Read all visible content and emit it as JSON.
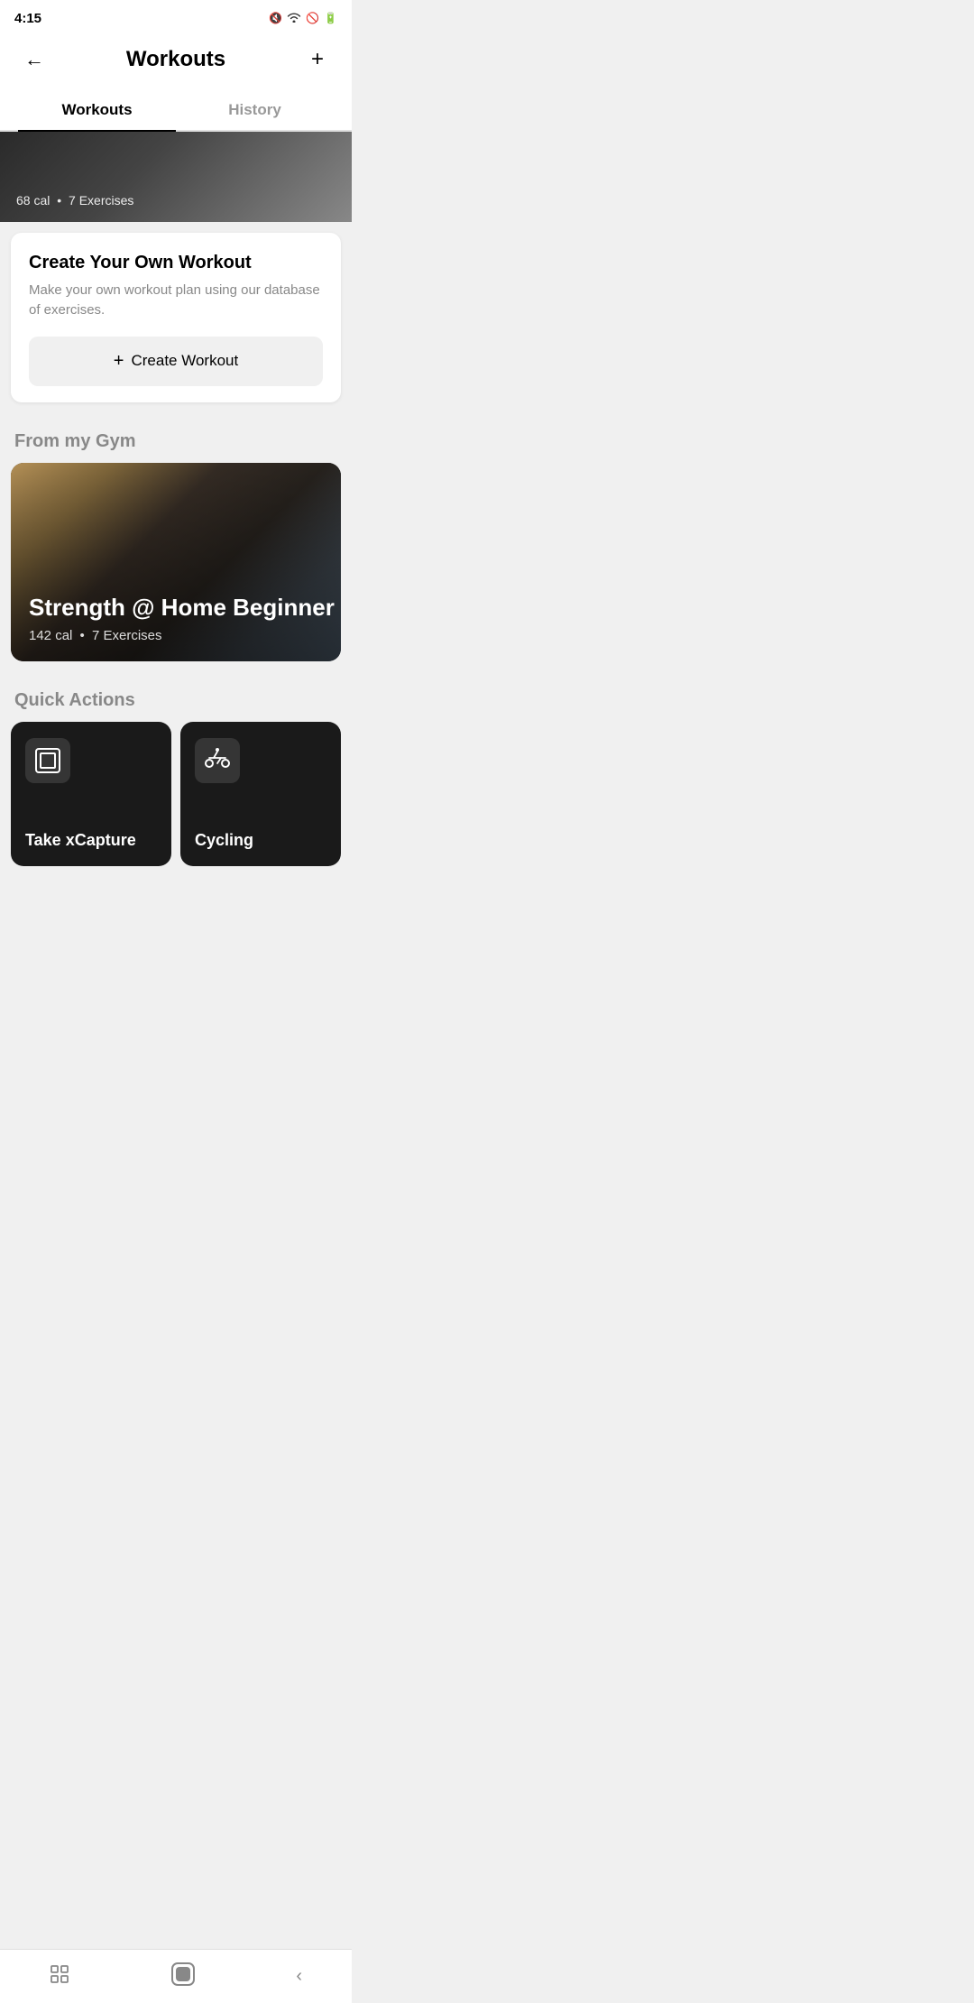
{
  "statusBar": {
    "time": "4:15",
    "icons": [
      "muted",
      "wifi",
      "block",
      "battery"
    ]
  },
  "header": {
    "title": "Workouts",
    "backLabel": "←",
    "addLabel": "+"
  },
  "tabs": [
    {
      "id": "workouts",
      "label": "Workouts",
      "active": true
    },
    {
      "id": "history",
      "label": "History",
      "active": false
    }
  ],
  "topWorkout": {
    "calories": "68 cal",
    "exercises": "7 Exercises"
  },
  "createWorkout": {
    "title": "Create Your Own Workout",
    "description": "Make your own workout plan using our database of exercises.",
    "buttonLabel": "Create Workout",
    "buttonPlus": "+"
  },
  "fromMyGym": {
    "sectionTitle": "From my Gym",
    "card": {
      "title": "Strength @ Home Beginner",
      "calories": "142 cal",
      "exercises": "7 Exercises"
    }
  },
  "quickActions": {
    "sectionTitle": "Quick Actions",
    "cards": [
      {
        "id": "capture",
        "label": "Take xCapture",
        "iconType": "capture"
      },
      {
        "id": "cycling",
        "label": "Cycling",
        "iconType": "cycling"
      }
    ]
  },
  "bottomNav": {
    "centerIcon": "⬜"
  }
}
